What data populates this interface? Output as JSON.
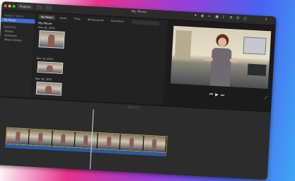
{
  "window": {
    "title": "My Movie",
    "projects_label": "Projects",
    "accent": "#3c6fd4"
  },
  "sidebar": {
    "project_header": "PROJECT MEDIA",
    "project_item": "My Movie",
    "libraries_header": "LIBRARIES",
    "items": [
      "Photos",
      "All Events",
      "iMovie Library"
    ]
  },
  "browser": {
    "tabs": [
      "My Media",
      "Audio",
      "Titles",
      "Backgrounds",
      "Transitions"
    ],
    "project_title": "My Movie",
    "events": [
      "Nov 16, 2015",
      "Nov 16, 2015",
      "Nov 16, 2015"
    ]
  },
  "timeline": {
    "header": "Total 1:12",
    "frame_count": 7
  },
  "icons": [
    "search-icon",
    "gear-icon",
    "play-icon",
    "skip-back-icon",
    "skip-forward-icon",
    "fullscreen-icon"
  ]
}
